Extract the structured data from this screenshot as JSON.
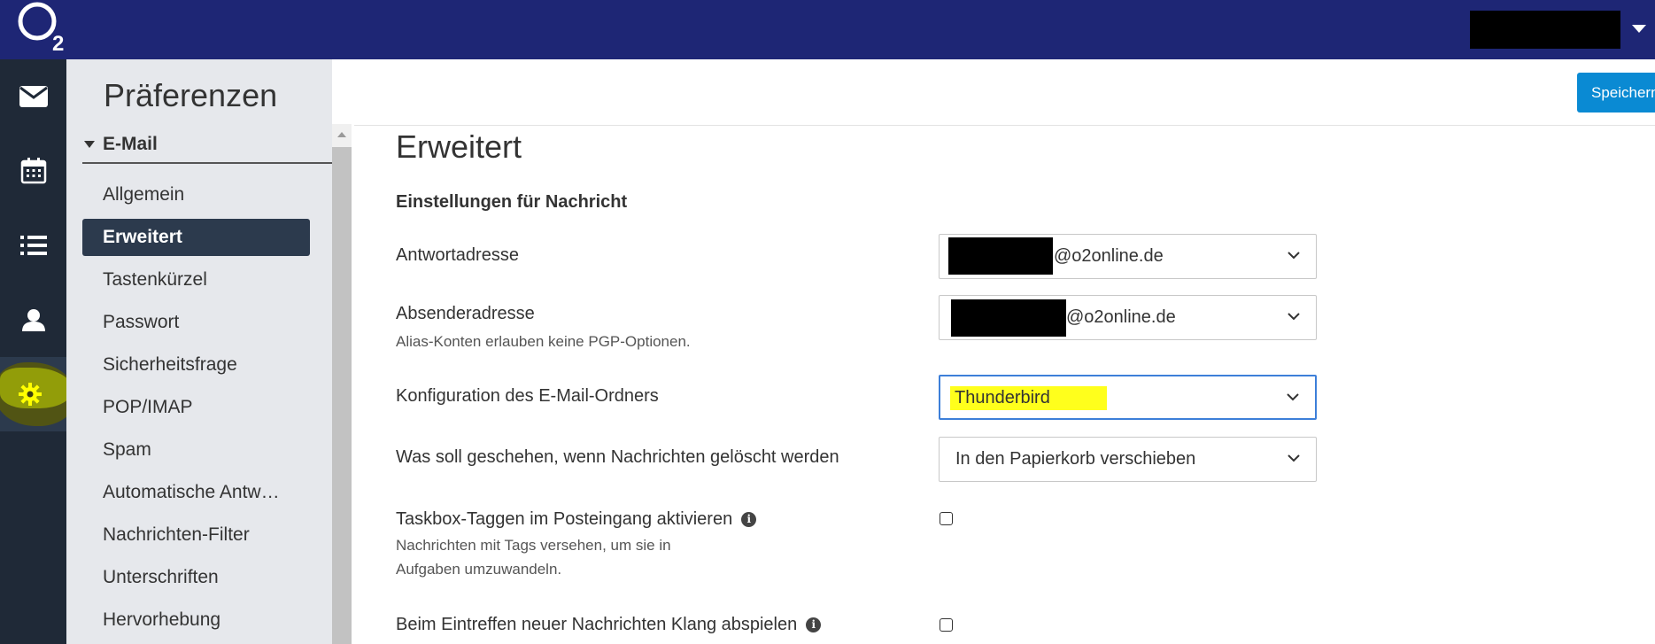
{
  "header": {
    "logo_text": "O₂",
    "user_menu_caret": "caret-down-icon"
  },
  "iconbar": {
    "items": [
      {
        "name": "mail",
        "icon": "envelope-icon"
      },
      {
        "name": "calendar",
        "icon": "calendar-icon"
      },
      {
        "name": "tasks",
        "icon": "list-icon"
      },
      {
        "name": "contacts",
        "icon": "person-icon"
      },
      {
        "name": "settings",
        "icon": "gear-icon",
        "active": true
      }
    ]
  },
  "nav": {
    "title": "Präferenzen",
    "section": "E-Mail",
    "items": [
      {
        "label": "Allgemein"
      },
      {
        "label": "Erweitert",
        "active": true
      },
      {
        "label": "Tastenkürzel"
      },
      {
        "label": "Passwort"
      },
      {
        "label": "Sicherheitsfrage"
      },
      {
        "label": "POP/IMAP"
      },
      {
        "label": "Spam"
      },
      {
        "label": "Automatische Antw…"
      },
      {
        "label": "Nachrichten-Filter"
      },
      {
        "label": "Unterschriften"
      },
      {
        "label": "Hervorhebung"
      }
    ]
  },
  "toolbar": {
    "save_label": "Speichern"
  },
  "main": {
    "title": "Erweitert",
    "section_title": "Einstellungen für Nachricht",
    "reply_address": {
      "label": "Antwortadresse",
      "value_suffix": "@o2online.de"
    },
    "sender_address": {
      "label": "Absenderadresse",
      "hint": "Alias-Konten erlauben keine PGP-Optionen.",
      "value_suffix": "@o2online.de"
    },
    "folder_config": {
      "label": "Konfiguration des E-Mail-Ordners",
      "value": "Thunderbird"
    },
    "delete_action": {
      "label": "Was soll geschehen, wenn Nachrichten gelöscht werden",
      "value": "In den Papierkorb verschieben"
    },
    "taskbox_tagging": {
      "label": "Taskbox-Taggen im Posteingang aktivieren",
      "hint_line1": "Nachrichten mit Tags versehen, um sie in",
      "hint_line2": "Aufgaben umzuwandeln.",
      "checked": false
    },
    "new_mail_sound": {
      "label": "Beim Eintreffen neuer Nachrichten Klang abspielen",
      "checked": false
    }
  },
  "colors": {
    "header_bg": "#1e2675",
    "iconbar_bg": "#1f2937",
    "nav_bg": "#e6e8ec",
    "active_nav": "#2c3a4d",
    "primary_button": "#0a8ad3",
    "highlight": "#ffff1c"
  }
}
